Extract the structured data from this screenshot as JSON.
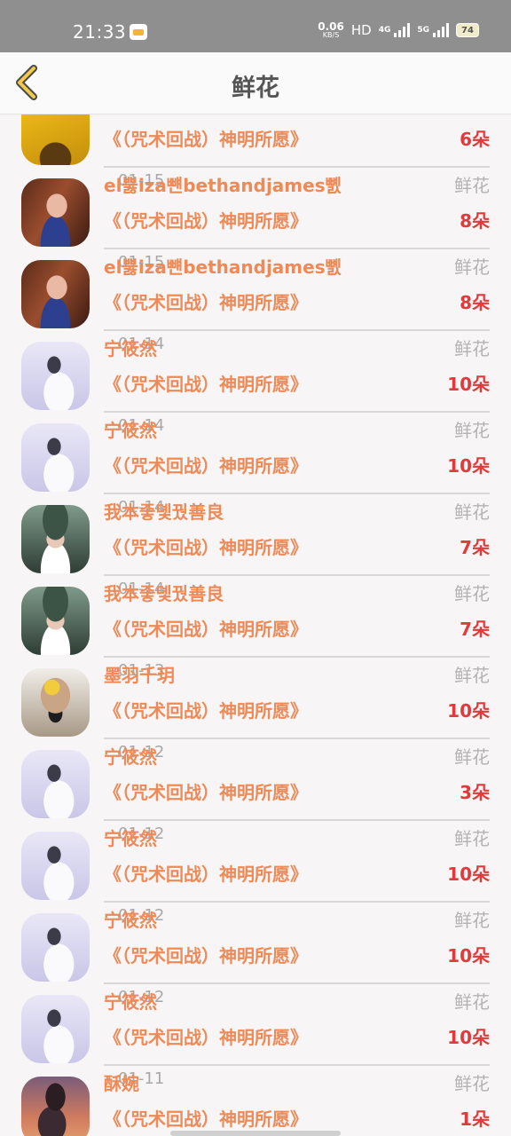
{
  "status_bar": {
    "time": "21:33",
    "net_speed_value": "0.06",
    "net_speed_unit": "KB/S",
    "hd": "HD",
    "net_4g": "4G",
    "net_5g": "5G",
    "battery": "74"
  },
  "header": {
    "title": "鲜花"
  },
  "colors": {
    "name": "#ee8a57",
    "count": "#e23a3a",
    "muted": "#a8a8a8"
  },
  "rows": [
    {
      "name": "",
      "date": "",
      "gift": "",
      "work": "《（咒术回战）神明所愿》",
      "count": "6朵",
      "avatar": "gold-yellow"
    },
    {
      "name": "el뿛iza뺸bethandjames뼰",
      "date": "01-15",
      "gift": "鲜花",
      "work": "《（咒术回战）神明所愿》",
      "count": "8朵",
      "avatar": "brown-hair"
    },
    {
      "name": "el뿛iza뺸bethandjames뼰",
      "date": "01-15",
      "gift": "鲜花",
      "work": "《（咒术回战）神明所愿》",
      "count": "8朵",
      "avatar": "brown-hair"
    },
    {
      "name": "宁筱然",
      "date": "01-14",
      "gift": "鲜花",
      "work": "《（咒术回战）神明所愿》",
      "count": "10朵",
      "avatar": "lavender-girl"
    },
    {
      "name": "宁筱然",
      "date": "01-14",
      "gift": "鲜花",
      "work": "《（咒术回战）神明所愿》",
      "count": "10朵",
      "avatar": "lavender-girl"
    },
    {
      "name": "我本좋뎿꿨善良",
      "date": "01-14",
      "gift": "鲜花",
      "work": "《（咒术回战）神明所愿》",
      "count": "7朵",
      "avatar": "green-cap"
    },
    {
      "name": "我本좋뎿꿨善良",
      "date": "01-14",
      "gift": "鲜花",
      "work": "《（咒术回战）神明所愿》",
      "count": "7朵",
      "avatar": "green-cap"
    },
    {
      "name": "墨羽千玥",
      "date": "01-13",
      "gift": "鲜花",
      "work": "《（咒术回战）神明所愿》",
      "count": "10朵",
      "avatar": "anime-star"
    },
    {
      "name": "宁筱然",
      "date": "01-12",
      "gift": "鲜花",
      "work": "《（咒术回战）神明所愿》",
      "count": "3朵",
      "avatar": "lavender-girl"
    },
    {
      "name": "宁筱然",
      "date": "01-12",
      "gift": "鲜花",
      "work": "《（咒术回战）神明所愿》",
      "count": "10朵",
      "avatar": "lavender-girl"
    },
    {
      "name": "宁筱然",
      "date": "01-12",
      "gift": "鲜花",
      "work": "《（咒术回战）神明所愿》",
      "count": "10朵",
      "avatar": "lavender-girl"
    },
    {
      "name": "宁筱然",
      "date": "01-12",
      "gift": "鲜花",
      "work": "《（咒术回战）神明所愿》",
      "count": "10朵",
      "avatar": "lavender-girl"
    },
    {
      "name": "酥婉",
      "date": "01-11",
      "gift": "鲜花",
      "work": "《（咒术回战）神明所愿》",
      "count": "1朵",
      "avatar": "sunset-boy"
    }
  ]
}
